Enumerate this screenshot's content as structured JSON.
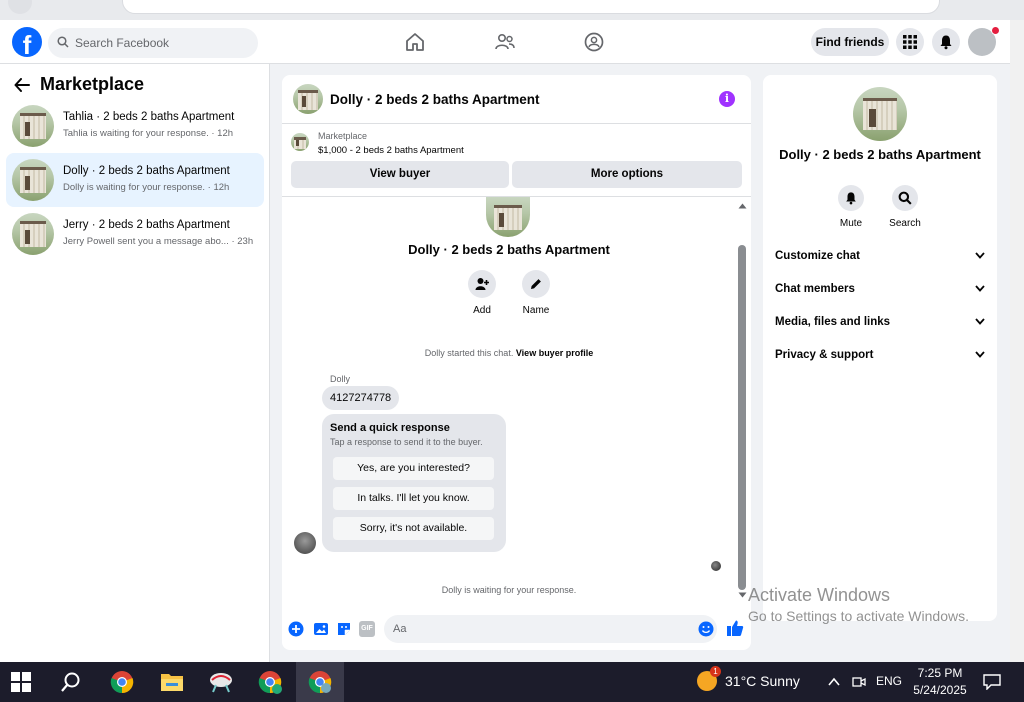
{
  "header": {
    "search_placeholder": "Search Facebook",
    "find_friends_label": "Find friends"
  },
  "sidebar": {
    "title": "Marketplace",
    "conversations": [
      {
        "name": "Tahlia · 2 beds 2 baths Apartment",
        "snippet": "Tahlia is waiting for your response. · 12h"
      },
      {
        "name": "Dolly · 2 beds 2 baths Apartment",
        "snippet": "Dolly is waiting for your response. · 12h"
      },
      {
        "name": "Jerry · 2 beds 2 baths Apartment",
        "snippet": "Jerry Powell sent you a message abo... · 23h"
      }
    ]
  },
  "chat": {
    "title": "Dolly · 2 beds 2 baths Apartment",
    "marketplace_label": "Marketplace",
    "listing": "$1,000 - 2 beds 2 baths Apartment",
    "view_buyer_label": "View buyer",
    "more_options_label": "More options",
    "center_name": "Dolly · 2 beds 2 baths Apartment",
    "actions": [
      {
        "label": "Add"
      },
      {
        "label": "Name"
      }
    ],
    "started_text": "Dolly started this chat.",
    "view_buyer_profile": "View buyer profile",
    "sender": "Dolly",
    "message": "4127274778",
    "quick_title": "Send a quick response",
    "quick_subtitle": "Tap a response to send it to the buyer.",
    "quick_responses": [
      "Yes, are you interested?",
      "In talks. I'll let you know.",
      "Sorry, it's not available."
    ],
    "waiting_text": "Dolly is waiting for your response.",
    "composer_placeholder": "Aa",
    "gif_label": "GIF"
  },
  "right_panel": {
    "name": "Dolly · 2 beds 2 baths Apartment",
    "actions": [
      {
        "label": "Mute"
      },
      {
        "label": "Search"
      }
    ],
    "sections": [
      "Customize chat",
      "Chat members",
      "Media, files and links",
      "Privacy & support"
    ]
  },
  "watermark": {
    "line1": "Activate Windows",
    "line2": "Go to Settings to activate Windows."
  },
  "taskbar": {
    "weather": "31°C  Sunny",
    "lang": "ENG",
    "time": "7:25 PM",
    "date": "5/24/2025"
  },
  "colors": {
    "brand": "#0866ff",
    "active_bg": "#e7f3ff",
    "info": "#a033ff",
    "taskbar": "#1c1c2b"
  }
}
